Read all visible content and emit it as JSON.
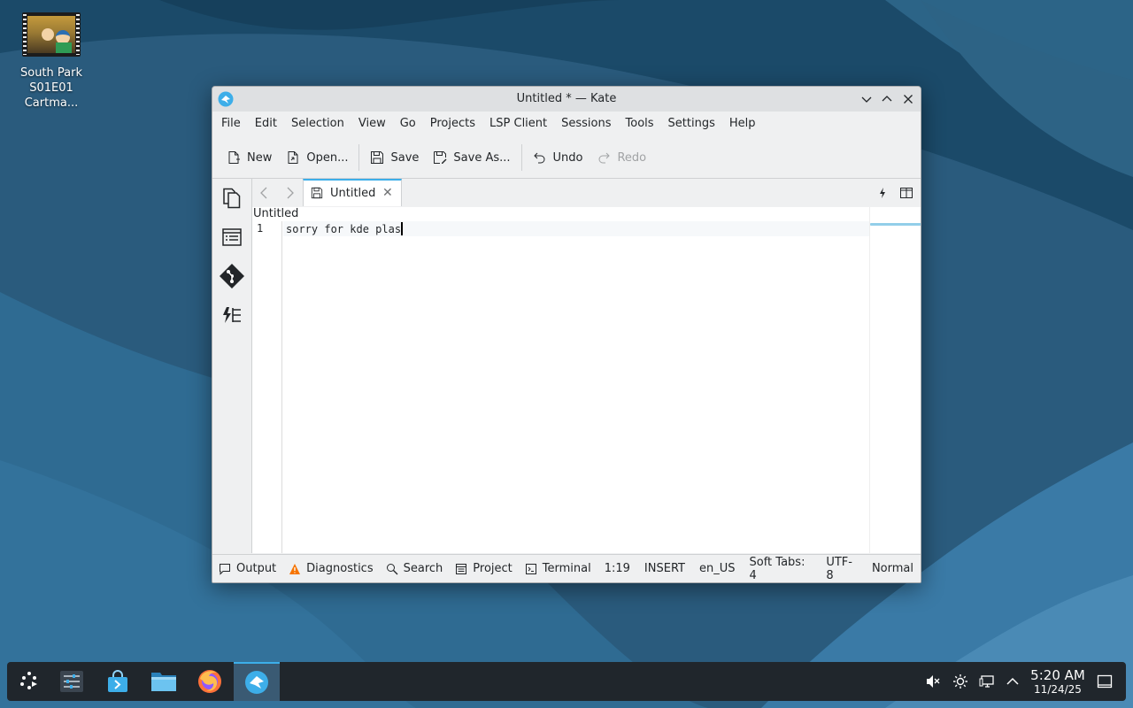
{
  "desktop": {
    "icon_label_line1": "South Park",
    "icon_label_line2": "S01E01 Cartma..."
  },
  "window": {
    "title": "Untitled * — Kate",
    "menu": [
      "File",
      "Edit",
      "Selection",
      "View",
      "Go",
      "Projects",
      "LSP Client",
      "Sessions",
      "Tools",
      "Settings",
      "Help"
    ],
    "toolbar": {
      "new": "New",
      "open": "Open...",
      "save": "Save",
      "save_as": "Save As...",
      "undo": "Undo",
      "redo": "Redo"
    },
    "tab": {
      "label": "Untitled"
    },
    "breadcrumb": "Untitled",
    "editor": {
      "line_number": "1",
      "text": "sorry for kde plas"
    },
    "statusbar": {
      "output": "Output",
      "diagnostics": "Diagnostics",
      "search": "Search",
      "project": "Project",
      "terminal": "Terminal",
      "cursor": "1:19",
      "mode": "INSERT",
      "language": "en_US",
      "indent": "Soft Tabs: 4",
      "encoding": "UTF-8",
      "input_mode": "Normal"
    }
  },
  "taskbar": {
    "clock_time": "5:20 AM",
    "clock_date": "11/24/25"
  },
  "colors": {
    "accent": "#3daee9",
    "warning": "#f67400",
    "panel": "#20262c"
  }
}
